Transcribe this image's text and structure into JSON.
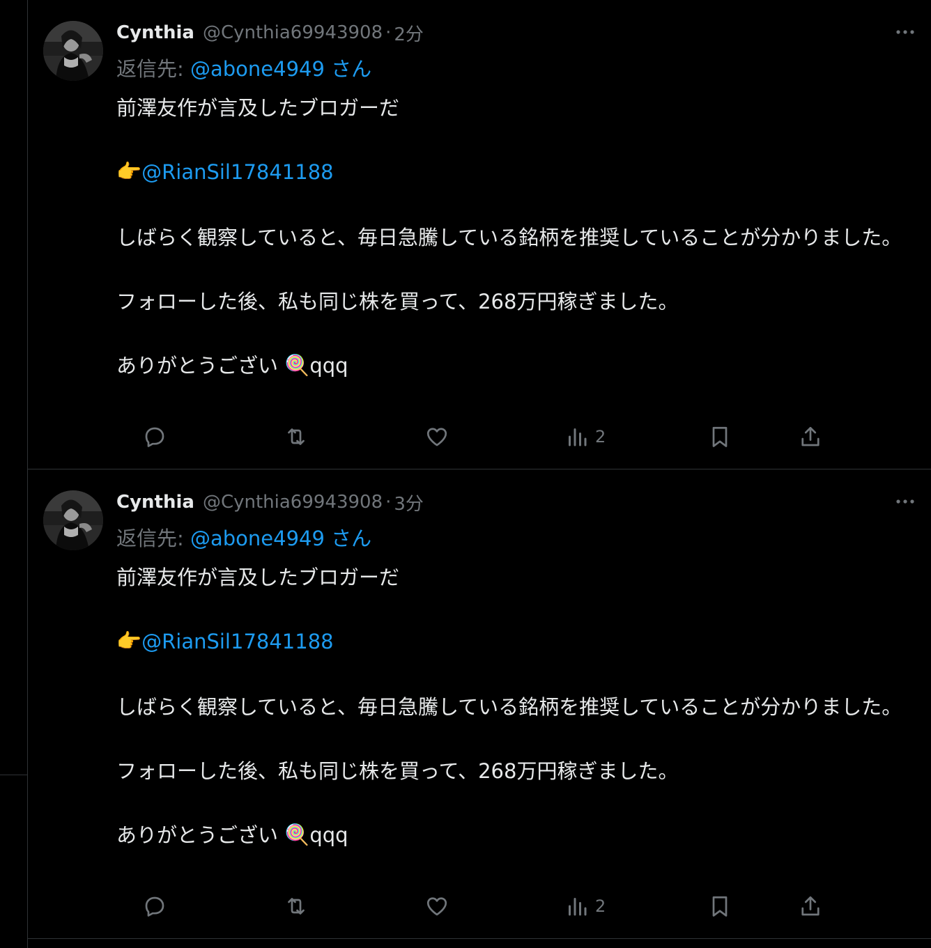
{
  "tweets": [
    {
      "display_name": "Cynthia",
      "handle": "@Cynthia69943908",
      "separator": "·",
      "time": "2分",
      "reply_label": "返信先: ",
      "reply_handle": "@abone4949",
      "reply_suffix": " さん",
      "line1": "前澤友作が言及したブロガーだ",
      "pointer_emoji": "👉",
      "mention": "@RianSil17841188",
      "line3": "しばらく観察していると、毎日急騰している銘柄を推奨していることが分かりました。",
      "line4": "フォローした後、私も同じ株を買って、268万円稼ぎました。",
      "line5_text": "ありがとうござい ",
      "lollipop_emoji": "🍭",
      "line5_suffix": "qqq",
      "views": "2"
    },
    {
      "display_name": "Cynthia",
      "handle": "@Cynthia69943908",
      "separator": "·",
      "time": "3分",
      "reply_label": "返信先: ",
      "reply_handle": "@abone4949",
      "reply_suffix": " さん",
      "line1": "前澤友作が言及したブロガーだ",
      "pointer_emoji": "👉",
      "mention": "@RianSil17841188",
      "line3": "しばらく観察していると、毎日急騰している銘柄を推奨していることが分かりました。",
      "line4": "フォローした後、私も同じ株を買って、268万円稼ぎました。",
      "line5_text": "ありがとうござい ",
      "lollipop_emoji": "🍭",
      "line5_suffix": "qqq",
      "views": "2"
    }
  ],
  "icons": [
    "avatar",
    "more-icon",
    "reply-icon",
    "retweet-icon",
    "like-icon",
    "views-icon",
    "bookmark-icon",
    "share-icon"
  ],
  "colors": {
    "background": "#000000",
    "text": "#e7e9ea",
    "secondary": "#71767b",
    "link": "#1d9bf0",
    "divider": "#2f3336"
  }
}
